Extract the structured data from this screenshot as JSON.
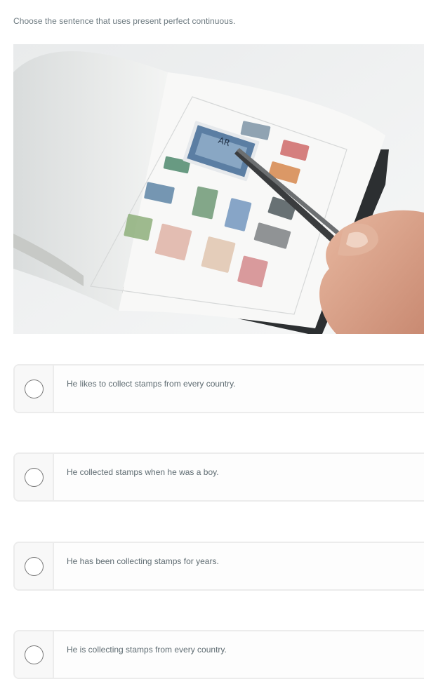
{
  "question": {
    "prompt": "Choose the sentence that uses present perfect continuous."
  },
  "image": {
    "subject": "stamp-album-with-tweezers"
  },
  "options": [
    {
      "label": "He likes to collect stamps from every country."
    },
    {
      "label": "He collected stamps when he was a boy."
    },
    {
      "label": "He has been collecting stamps for years."
    },
    {
      "label": "He is collecting stamps from every country."
    }
  ],
  "colors": {
    "text": "#6d7a80",
    "border": "#ececec",
    "radio_border": "#767676"
  }
}
